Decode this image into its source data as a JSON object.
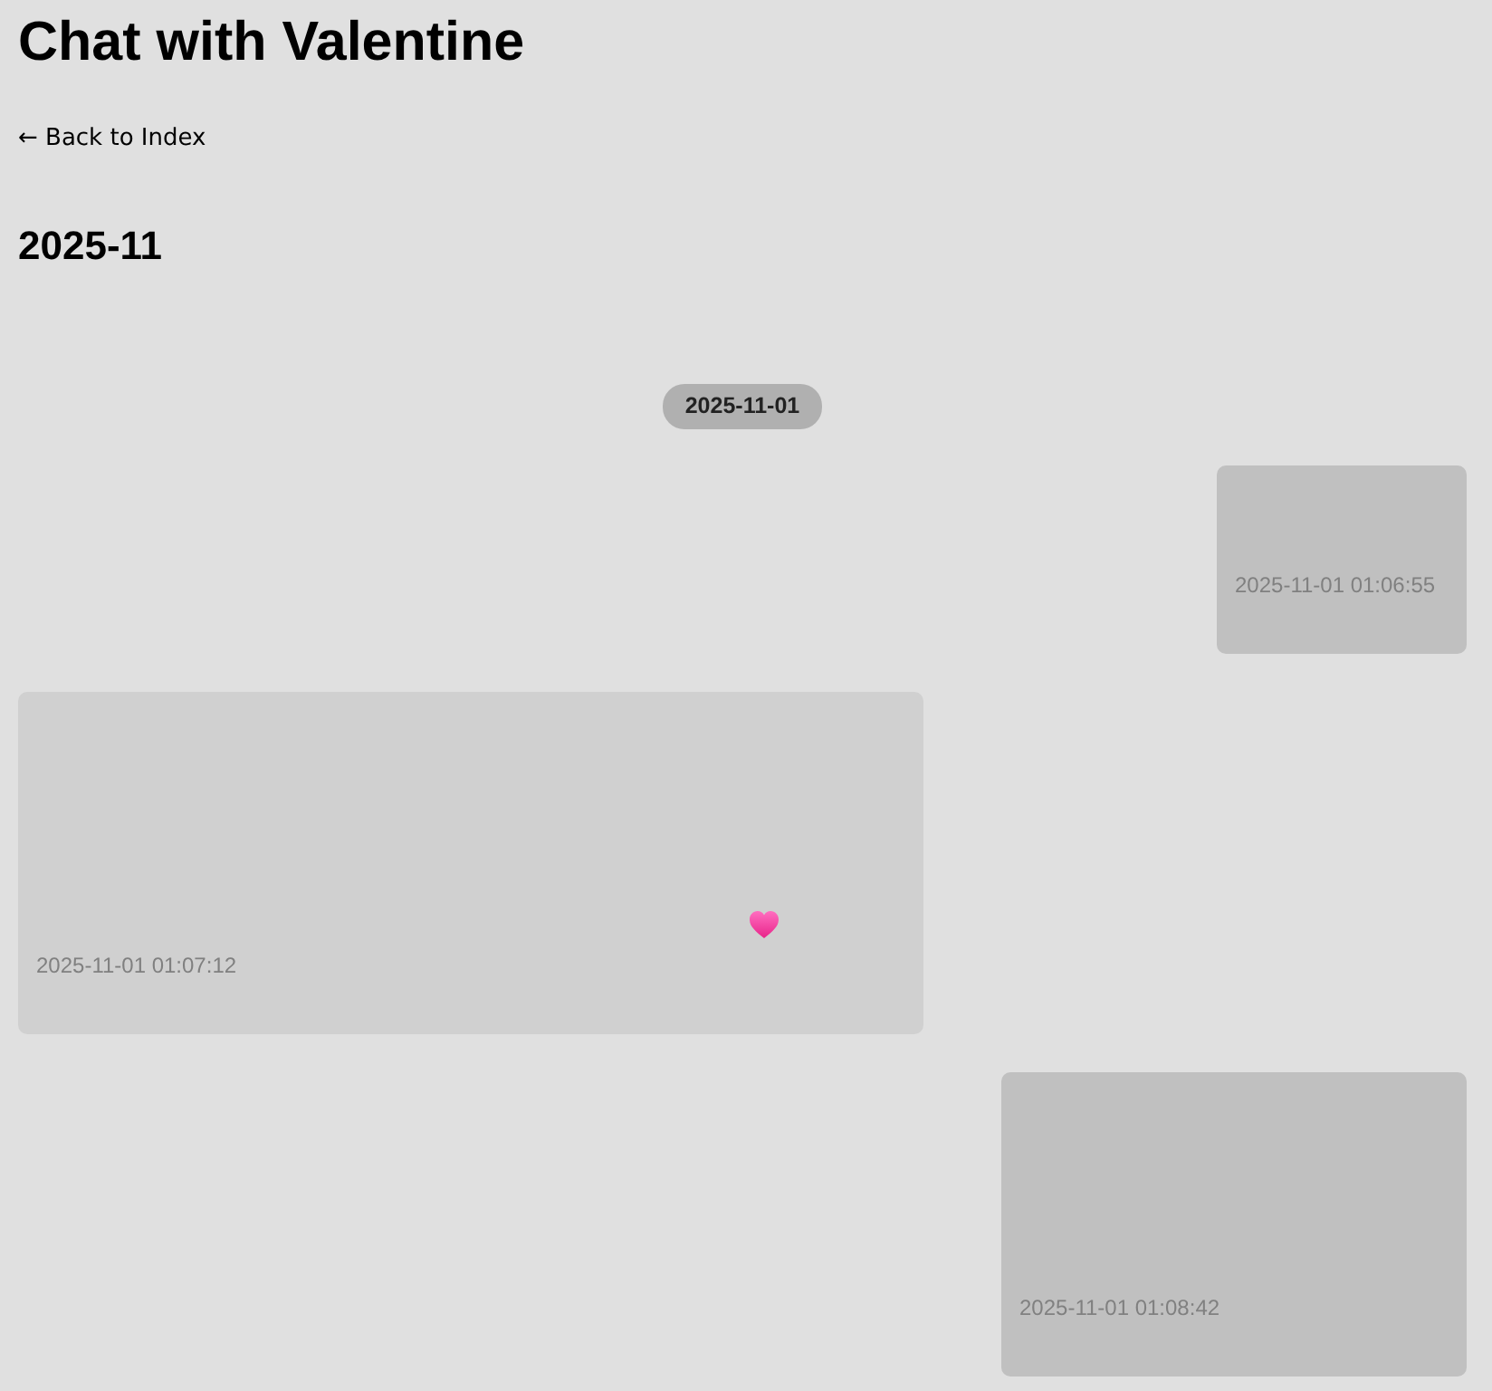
{
  "page": {
    "title": "Chat with Valentine",
    "back_link": "← Back to Index"
  },
  "month": "2025-11",
  "days": [
    {
      "date": "2025-11-01",
      "messages": [
        {
          "kind": "sent",
          "timestamp": "2025-11-01 01:06:55"
        },
        {
          "kind": "received",
          "timestamp": "2025-11-01 01:07:12",
          "heart": true
        },
        {
          "kind": "sent",
          "timestamp": "2025-11-01 01:08:42"
        }
      ]
    }
  ]
}
